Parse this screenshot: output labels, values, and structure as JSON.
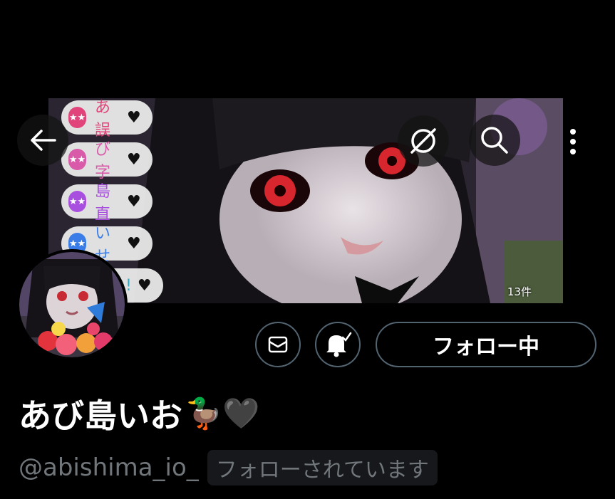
{
  "header": {
    "back_icon": "arrow-left-icon",
    "translate_icon": "translate-icon",
    "search_icon": "search-icon",
    "more_icon": "more-vertical-icon"
  },
  "banner": {
    "media_count": "13件",
    "pills": [
      {
        "text": "あ 誤",
        "color": "#e0447a",
        "heart": "♥"
      },
      {
        "text": "び 字",
        "color": "#d85aa8",
        "heart": "♥"
      },
      {
        "text": "島 直",
        "color": "#a94fe0",
        "heart": "♥"
      },
      {
        "text": "い せ",
        "color": "#3a7de8",
        "heart": "♥"
      },
      {
        "text": "!",
        "color": "#2fa8c8",
        "heart": "♥"
      }
    ]
  },
  "actions": {
    "message_icon": "envelope-icon",
    "notify_icon": "bell-check-icon",
    "follow_label": "フォロー中"
  },
  "profile": {
    "display_name": "あび島いお",
    "name_emojis": "🦆🖤",
    "handle": "@abishima_io_",
    "follows_you": "フォローされています"
  }
}
